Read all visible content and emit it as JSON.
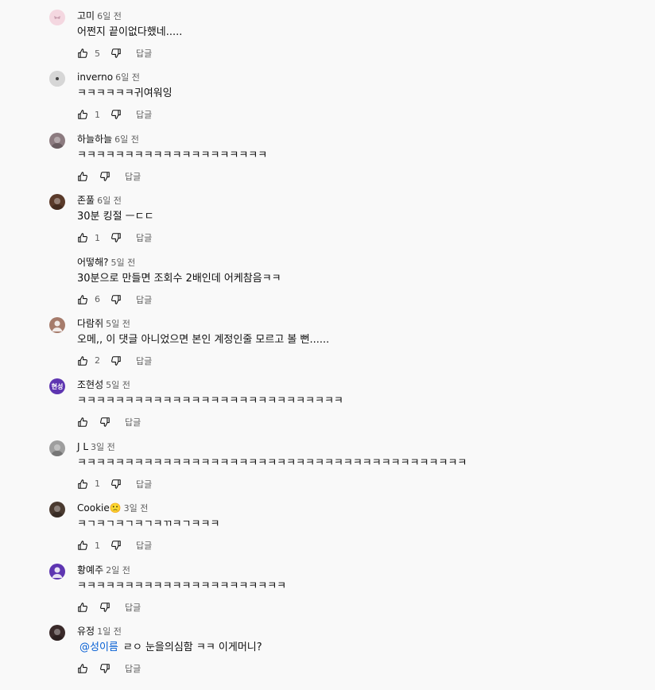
{
  "reply_label": "답글",
  "comments": [
    {
      "author": "고미",
      "time": "6일 전",
      "text": "어쩐지 끝이없다했네.....",
      "likes": "5",
      "avatar_color": "#f4d7e0",
      "avatar_icon": "bow-icon"
    },
    {
      "author": "inverno",
      "time": "6일 전",
      "text": "ㅋㅋㅋㅋㅋㅋ귀여워잉",
      "likes": "1",
      "avatar_color": "#cfcfcf",
      "avatar_icon": "dot-icon"
    },
    {
      "author": "하늘하늘",
      "time": "6일 전",
      "text": "ㅋㅋㅋㅋㅋㅋㅋㅋㅋㅋㅋㅋㅋㅋㅋㅋㅋㅋㅋㅋ",
      "likes": "",
      "avatar_color": "#8c7b80",
      "avatar_icon": "photo-icon"
    },
    {
      "author": "존풀",
      "time": "6일 전",
      "text": "30분 킹절 ㅡㄷㄷ",
      "likes": "1",
      "avatar_color": "#5a3a2a",
      "avatar_icon": "photo-icon"
    },
    {
      "author": "어떻해?",
      "time": "5일 전",
      "text": "30분으로 만들면 조회수 2배인데 어케참음ㅋㅋ",
      "likes": "6",
      "avatar_color": "#f9f9f9",
      "avatar_icon": "blank-icon"
    },
    {
      "author": "다람쥐",
      "time": "5일 전",
      "text": "오메,, 이 댓글 아니었으면 본인 계정인줄 모르고 볼 뻔......",
      "likes": "2",
      "avatar_color": "#a67b6b",
      "avatar_icon": "user-icon"
    },
    {
      "author": "조현성",
      "time": "5일 전",
      "text": "ㅋㅋㅋㅋㅋㅋㅋㅋㅋㅋㅋㅋㅋㅋㅋㅋㅋㅋㅋㅋㅋㅋㅋㅋㅋㅋㅋㅋ",
      "likes": "",
      "avatar_color": "#5e35b1",
      "avatar_text": "현성",
      "avatar_icon": "initials-icon"
    },
    {
      "author": "J L",
      "time": "3일 전",
      "text": "ㅋㅋㅋㅋㅋㅋㅋㅋㅋㅋㅋㅋㅋㅋㅋㅋㅋㅋㅋㅋㅋㅋㅋㅋㅋㅋㅋㅋㅋㅋㅋㅋㅋㅋㅋㅋㅋㅋㅋㅋㅋ",
      "likes": "1",
      "avatar_color": "#9e9e9e",
      "avatar_icon": "photo-icon"
    },
    {
      "author": "Cookie🙁",
      "time": "3일 전",
      "text": "ㅋㄱㅋㄱㅋㄱㅋㄱㅋㄲㅋㄱㅋㅋㅋ",
      "likes": "1",
      "avatar_color": "#4a3a30",
      "avatar_icon": "photo-icon"
    },
    {
      "author": "황예주",
      "time": "2일 전",
      "text": "ㅋㅋㅋㅋㅋㅋㅋㅋㅋㅋㅋㅋㅋㅋㅋㅋㅋㅋㅋㅋㅋㅋ",
      "likes": "",
      "avatar_color": "#5e35b1",
      "avatar_icon": "user-icon"
    },
    {
      "author": "유정",
      "time": "1일 전",
      "mention": "@성이름",
      "text": "ㄹㅇ 눈을의심함 ㅋㅋ 이게머니?",
      "likes": "",
      "avatar_color": "#3a2a2a",
      "avatar_icon": "photo-icon"
    }
  ]
}
